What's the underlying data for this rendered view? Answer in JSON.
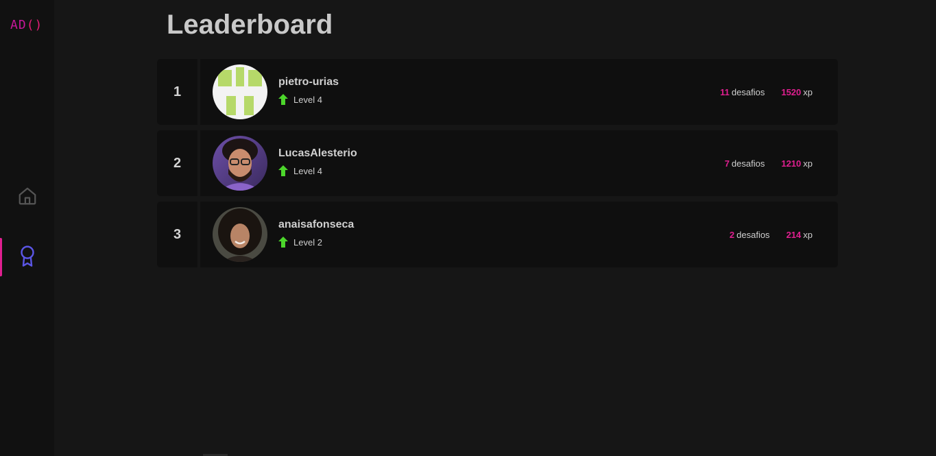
{
  "app": {
    "logo_text": "AD()",
    "logo_colors": {
      "letters": "#c7179a",
      "parens": "#e11d77"
    }
  },
  "sidebar": {
    "items": [
      {
        "id": "home",
        "icon": "home-icon",
        "active": false
      },
      {
        "id": "leaderboard",
        "icon": "award-ribbon-icon",
        "active": true
      }
    ],
    "accent": "#e01f90",
    "active_icon_color": "#5b56e6",
    "inactive_icon_color": "#555555"
  },
  "page": {
    "title": "Leaderboard"
  },
  "leaderboard": {
    "challenges_unit": "desafios",
    "xp_unit": "xp",
    "level_prefix": "Level",
    "level_icon": "arrow-up-icon",
    "level_icon_color": "#4cd62b",
    "entries": [
      {
        "position": "1",
        "username": "pietro-urias",
        "level": "4",
        "challenges": "11",
        "xp": "1520",
        "avatar": "identicon"
      },
      {
        "position": "2",
        "username": "LucasAlesterio",
        "level": "4",
        "challenges": "7",
        "xp": "1210",
        "avatar": "photo"
      },
      {
        "position": "3",
        "username": "anaisafonseca",
        "level": "2",
        "challenges": "2",
        "xp": "214",
        "avatar": "photo"
      }
    ]
  }
}
